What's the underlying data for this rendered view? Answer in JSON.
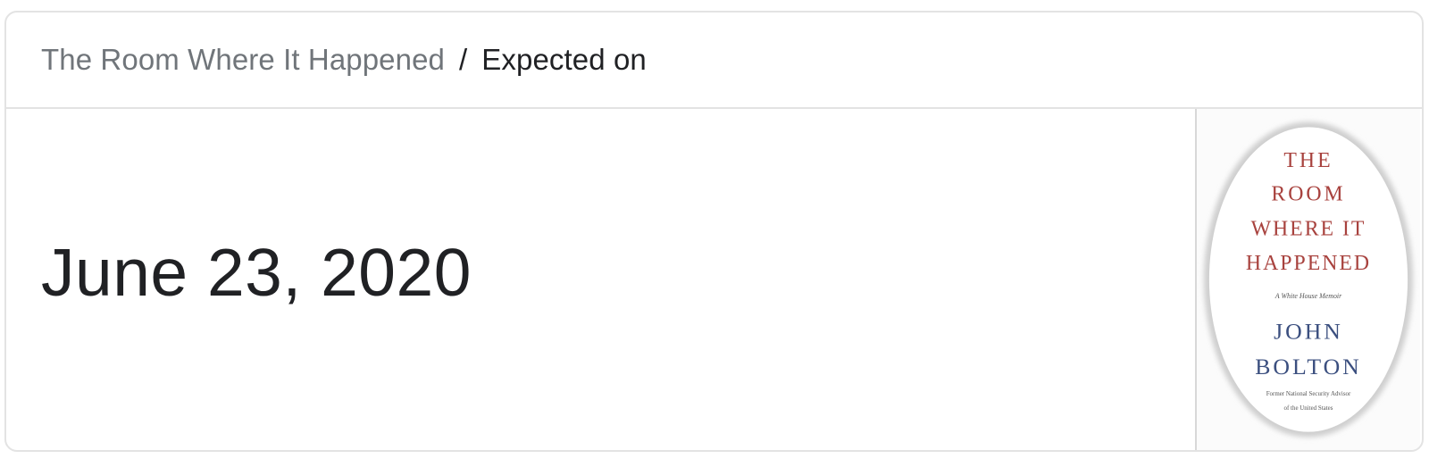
{
  "breadcrumb": {
    "parent": "The Room Where It Happened",
    "separator": "/",
    "current": "Expected on"
  },
  "release": {
    "date": "June 23, 2020"
  },
  "book_cover": {
    "title_lines": [
      "THE",
      "ROOM",
      "WHERE IT",
      "HAPPENED"
    ],
    "subtitle": "A White House Memoir",
    "author_lines": [
      "JOHN",
      "BOLTON"
    ],
    "author_caption_lines": [
      "Former National Security Advisor",
      "of the United States"
    ],
    "title_color": "#a8423e",
    "author_color": "#3b4f7f"
  }
}
